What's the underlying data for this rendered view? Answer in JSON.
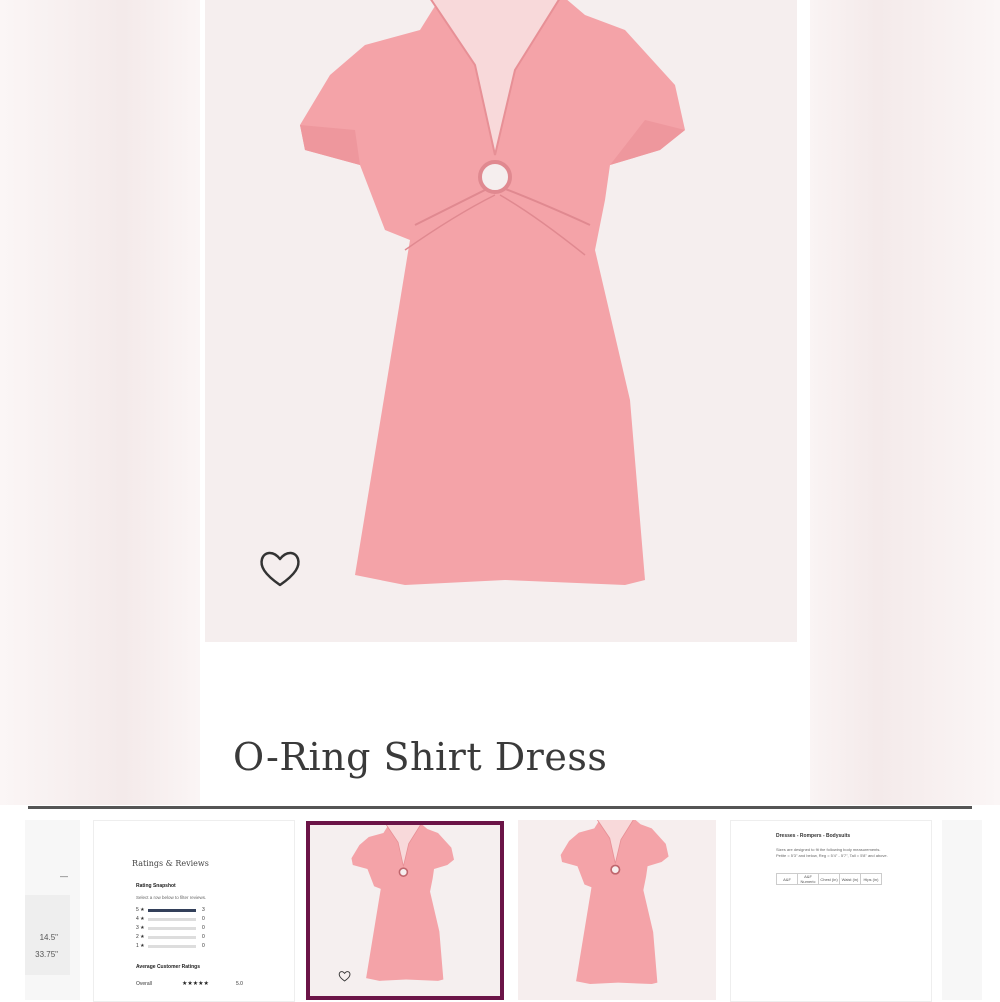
{
  "product": {
    "title": "O-Ring Shirt Dress",
    "wishlist_icon": "heart-outline-icon"
  },
  "colors": {
    "dress": "#f4a3a8",
    "selected_border": "#6b1447"
  },
  "thumbnails": {
    "partial": {
      "label_1": "—",
      "label_2": "14.5\"",
      "label_3": "33.75\""
    },
    "reviews": {
      "heading": "Ratings & Reviews",
      "snapshot": "Rating Snapshot",
      "select_hint": "Select a row below to filter reviews.",
      "rows": [
        {
          "label": "5 ★",
          "count": "3",
          "fraction": 1.0
        },
        {
          "label": "4 ★",
          "count": "0",
          "fraction": 0
        },
        {
          "label": "3 ★",
          "count": "0",
          "fraction": 0
        },
        {
          "label": "2 ★",
          "count": "0",
          "fraction": 0
        },
        {
          "label": "1 ★",
          "count": "0",
          "fraction": 0
        }
      ],
      "average_heading": "Average Customer Ratings",
      "overall_label": "Overall",
      "overall_stars": "★★★★★",
      "overall_value": "5.0"
    },
    "size_chart": {
      "heading": "Dresses - Rompers - Bodysuits",
      "paragraph": "Sizes are designed to fit the following body measurements. Petite = 5'3\" and below, Reg = 5'4\" - 5'7\", Tall = 5'8\" and above.",
      "columns": [
        "A&F",
        "A&F Numeric",
        "Chest (in)",
        "Waist (in)",
        "Hips (in)"
      ]
    }
  }
}
